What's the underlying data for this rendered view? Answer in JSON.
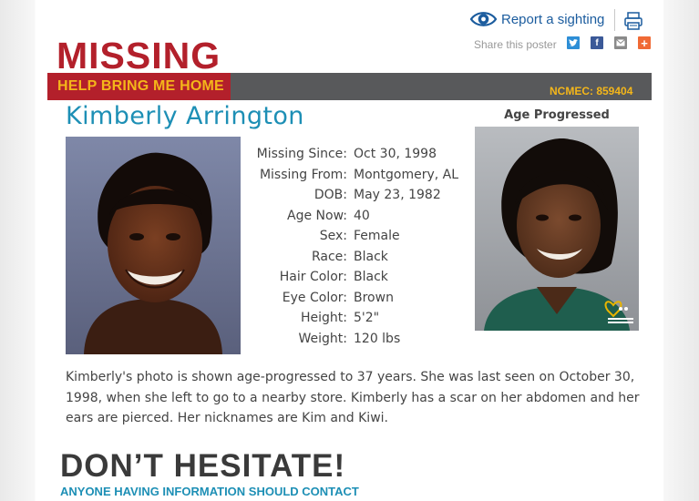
{
  "header": {
    "report_label": "Report a sighting",
    "share_label": "Share this poster",
    "share_buttons": [
      {
        "name": "twitter-icon",
        "glyph": ""
      },
      {
        "name": "facebook-icon",
        "glyph": "f"
      },
      {
        "name": "email-icon",
        "glyph": ""
      },
      {
        "name": "more-share-icon",
        "glyph": "+"
      }
    ]
  },
  "banner": {
    "title": "MISSING",
    "subtitle": "HELP BRING ME HOME",
    "case_id": "NCMEC: 859404"
  },
  "person": {
    "name": "Kimberly Arrington",
    "age_progressed_label": "Age Progressed",
    "details": [
      {
        "label": "Missing Since:",
        "value": "Oct 30, 1998"
      },
      {
        "label": "Missing From:",
        "value": "Montgomery, AL"
      },
      {
        "label": "DOB:",
        "value": "May 23, 1982"
      },
      {
        "label": "Age Now:",
        "value": "40"
      },
      {
        "label": "Sex:",
        "value": "Female"
      },
      {
        "label": "Race:",
        "value": "Black"
      },
      {
        "label": "Hair Color:",
        "value": "Black"
      },
      {
        "label": "Eye Color:",
        "value": "Brown"
      },
      {
        "label": "Height:",
        "value": "5'2\""
      },
      {
        "label": "Weight:",
        "value": "120 lbs"
      }
    ],
    "description": "Kimberly's photo is shown age-progressed to 37 years. She was last seen on October 30, 1998, when she left to go to a nearby store. Kimberly has a scar on her abdomen and her ears are pierced. Her nicknames are Kim and Kiwi."
  },
  "cta": {
    "headline": "DON’T HESITATE!",
    "subline": "ANYONE HAVING INFORMATION SHOULD CONTACT"
  },
  "colors": {
    "brand_red": "#b3202b",
    "banner_gray": "#58595b",
    "gold": "#f4b61a",
    "name_blue": "#1d8fb5",
    "link_blue": "#1b5c9e"
  }
}
